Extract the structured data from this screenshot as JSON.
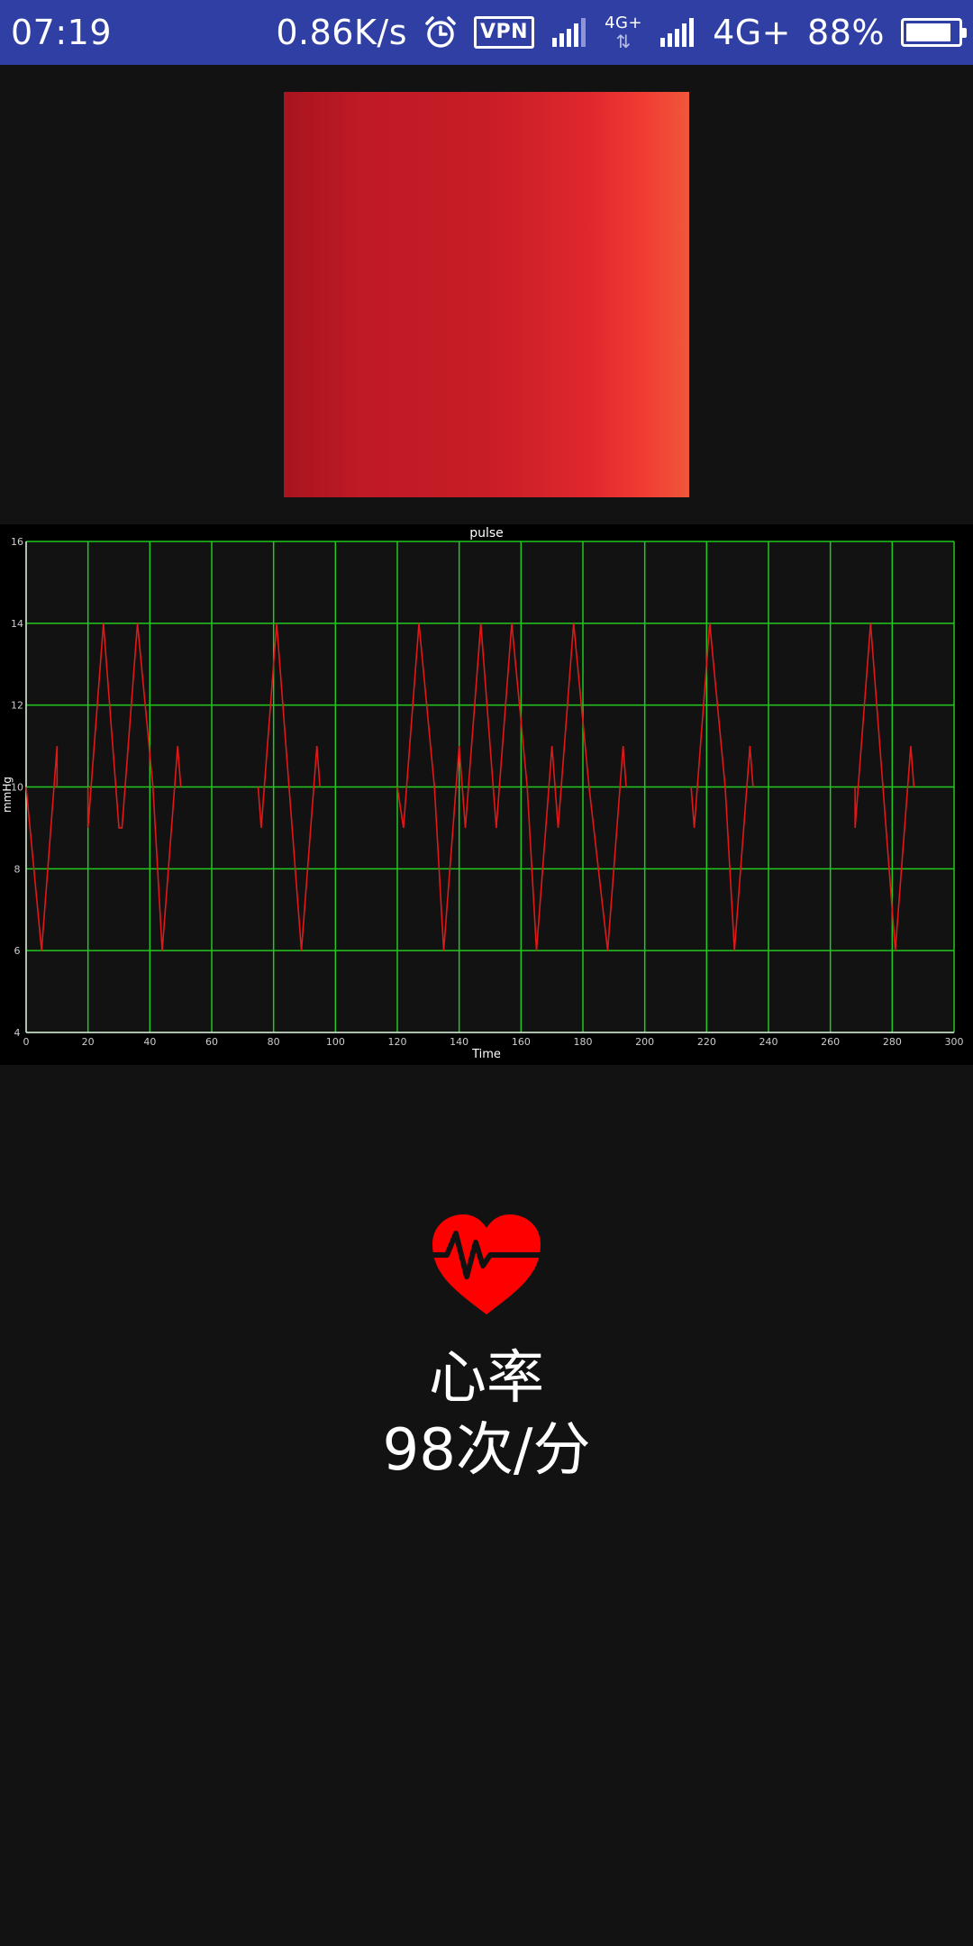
{
  "status_bar": {
    "time": "07:19",
    "net_speed": "0.86K/s",
    "vpn": "VPN",
    "net_type_small": "4G+",
    "net_type": "4G+",
    "battery": "88%",
    "battery_level": 0.88,
    "icons": [
      "alarm-icon",
      "vpn-icon",
      "signal-icon",
      "signal-icon",
      "battery-icon"
    ]
  },
  "heart": {
    "label": "心率",
    "value": "98次/分",
    "icon": "heart-pulse-icon",
    "color": "#ff0000"
  },
  "chart_data": {
    "type": "line",
    "title": "pulse",
    "xlabel": "Time",
    "ylabel": "mmHg",
    "xlim": [
      0,
      300
    ],
    "ylim": [
      4,
      16
    ],
    "xticks": [
      0,
      20,
      40,
      60,
      80,
      100,
      120,
      140,
      160,
      180,
      200,
      220,
      240,
      260,
      280,
      300
    ],
    "yticks": [
      4,
      6,
      8,
      10,
      12,
      14,
      16
    ],
    "grid": true,
    "grid_color": "#22c81e",
    "line_color": "#e01818",
    "series": [
      {
        "segments": [
          [
            [
              0,
              10
            ],
            [
              5,
              6
            ],
            [
              10,
              11
            ],
            [
              10,
              10
            ]
          ],
          [
            [
              20,
              10
            ],
            [
              20,
              9
            ],
            [
              25,
              14
            ],
            [
              30,
              9
            ],
            [
              31,
              9
            ],
            [
              36,
              14
            ],
            [
              41,
              10
            ],
            [
              44,
              6
            ],
            [
              49,
              11
            ],
            [
              50,
              10
            ]
          ],
          [
            [
              75,
              10
            ],
            [
              76,
              9
            ],
            [
              81,
              14
            ],
            [
              86,
              9
            ],
            [
              89,
              6
            ],
            [
              94,
              11
            ],
            [
              95,
              10
            ]
          ],
          [
            [
              120,
              10
            ],
            [
              122,
              9
            ],
            [
              127,
              14
            ],
            [
              132,
              10
            ],
            [
              135,
              6
            ],
            [
              140,
              11
            ],
            [
              142,
              9
            ],
            [
              147,
              14
            ],
            [
              152,
              9
            ],
            [
              157,
              14
            ],
            [
              162,
              10
            ],
            [
              165,
              6
            ],
            [
              170,
              11
            ],
            [
              172,
              9
            ],
            [
              177,
              14
            ],
            [
              182,
              10
            ],
            [
              188,
              6
            ],
            [
              193,
              11
            ],
            [
              194,
              10
            ]
          ],
          [
            [
              215,
              10
            ],
            [
              216,
              9
            ],
            [
              221,
              14
            ],
            [
              226,
              10
            ],
            [
              229,
              6
            ],
            [
              234,
              11
            ],
            [
              235,
              10
            ]
          ],
          [
            [
              268,
              10
            ],
            [
              268,
              9
            ],
            [
              273,
              14
            ],
            [
              278,
              9
            ],
            [
              281,
              6
            ],
            [
              286,
              11
            ],
            [
              287,
              10
            ]
          ]
        ]
      }
    ]
  }
}
